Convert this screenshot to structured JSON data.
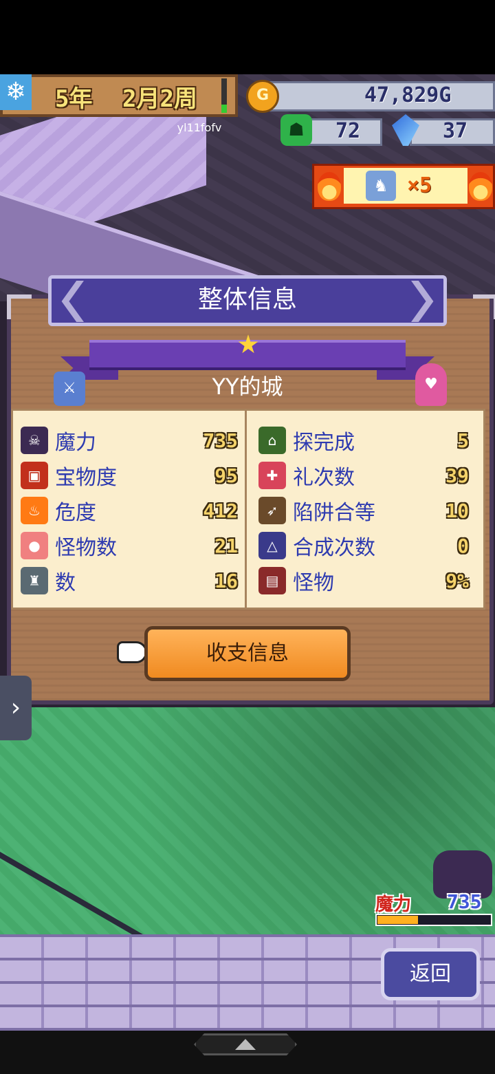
{
  "hud": {
    "year": "5年",
    "month_week": "2月2周",
    "username": "yl11fofv",
    "gold": "47,829G",
    "dog_count": "72",
    "crystal_count": "37",
    "hero_multiplier": "×5"
  },
  "panel": {
    "title": "整体信息",
    "castle_name": "YY的城",
    "stats_left": [
      {
        "icon": "demon-icon",
        "label": "魔力",
        "value": "735",
        "color": "#3c2a52"
      },
      {
        "icon": "treasure-chest-icon",
        "label": "宝物度",
        "value": "95",
        "color": "#c2301c"
      },
      {
        "icon": "fire-icon",
        "label": "危度",
        "value": "412",
        "color": "#ff7a14"
      },
      {
        "icon": "slime-icon",
        "label": "怪物数",
        "value": "21",
        "color": "#f08080"
      },
      {
        "icon": "statue-icon",
        "label": "数",
        "value": "16",
        "color": "#5a6a72"
      }
    ],
    "stats_right": [
      {
        "icon": "cave-icon",
        "label": "探完成",
        "value": "5",
        "color": "#3a6a2a"
      },
      {
        "icon": "gift-icon",
        "label": "礼次数",
        "value": "39",
        "color": "#d8445a"
      },
      {
        "icon": "bow-trap-icon",
        "label": "陷阱合等",
        "value": "10",
        "color": "#6a4a2a"
      },
      {
        "icon": "synthesis-icon",
        "label": "合成次数",
        "value": "0",
        "color": "#3a3a8a"
      },
      {
        "icon": "book-icon",
        "label": "怪物",
        "value": "9%",
        "color": "#8a2a2a"
      }
    ],
    "income_button": "收支信息"
  },
  "status": {
    "mana_label": "魔力",
    "mana_value": "735",
    "mana_fill_fraction": 0.36
  },
  "back_button": "返回"
}
